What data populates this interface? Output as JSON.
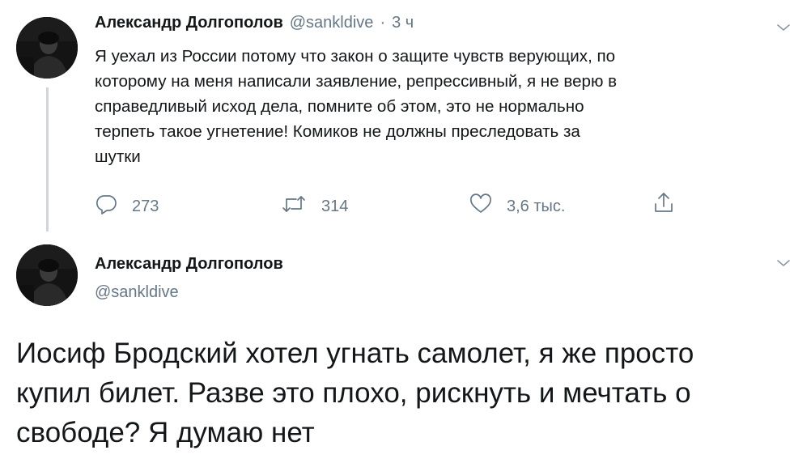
{
  "tweet1": {
    "author_name": "Александр Долгополов",
    "handle": "@sankldive",
    "separator": "·",
    "time": "3 ч",
    "text": "Я уехал из России потому что закон о защите чувств верующих, по\nкоторому на меня написали заявление, репрессивный, я не верю в\nсправедливый исход дела, помните об этом, это не нормально\nтерпеть такое угнетение! Комиков не должны преследовать за\nшутки",
    "replies": "273",
    "retweets": "314",
    "likes": "3,6 тыс."
  },
  "tweet2": {
    "author_name": "Александр Долгополов",
    "handle": "@sankldive",
    "text": "Иосиф Бродский хотел угнать самолет, я же просто\nкупил билет. Разве это плохо, рискнуть и мечтать о\nсвободе? Я думаю нет"
  },
  "icons": {
    "reply": "reply-icon",
    "retweet": "retweet-icon",
    "like": "heart-icon",
    "share": "share-icon",
    "more": "chevron-down-icon"
  },
  "colors": {
    "text": "#14171a",
    "secondary": "#657786",
    "thread_line": "#ccd6dd"
  }
}
